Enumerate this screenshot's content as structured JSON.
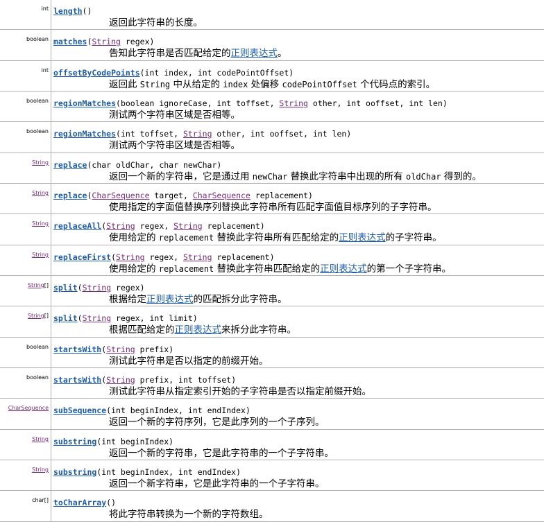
{
  "rows": [
    {
      "type": [
        {
          "text": "int"
        }
      ],
      "name": "length",
      "params": [
        {
          "text": "()"
        }
      ],
      "desc": [
        {
          "text": "返回此字符串的长度。"
        }
      ]
    },
    {
      "type": [
        {
          "text": "boolean"
        }
      ],
      "name": "matches",
      "params": [
        {
          "text": "("
        },
        {
          "text": "String",
          "link": true
        },
        {
          "text": " regex)"
        }
      ],
      "desc": [
        {
          "text": "告知此字符串是否匹配给定的"
        },
        {
          "text": "正则表达式",
          "link": true
        },
        {
          "text": "。"
        }
      ]
    },
    {
      "type": [
        {
          "text": "int"
        }
      ],
      "name": "offsetByCodePoints",
      "params": [
        {
          "text": "(int index, int codePointOffset)"
        }
      ],
      "desc": [
        {
          "text": "返回此 "
        },
        {
          "text": "String",
          "code": true
        },
        {
          "text": " 中从给定的 "
        },
        {
          "text": "index",
          "code": true
        },
        {
          "text": " 处偏移 "
        },
        {
          "text": "codePointOffset",
          "code": true
        },
        {
          "text": " 个代码点的索引。"
        }
      ]
    },
    {
      "type": [
        {
          "text": "boolean"
        }
      ],
      "name": "regionMatches",
      "params": [
        {
          "text": "(boolean ignoreCase, int toffset, "
        },
        {
          "text": "String",
          "link": true
        },
        {
          "text": " other, int ooffset, int len)"
        }
      ],
      "desc": [
        {
          "text": "测试两个字符串区域是否相等。"
        }
      ]
    },
    {
      "type": [
        {
          "text": "boolean"
        }
      ],
      "name": "regionMatches",
      "params": [
        {
          "text": "(int toffset, "
        },
        {
          "text": "String",
          "link": true
        },
        {
          "text": " other, int ooffset, int len)"
        }
      ],
      "desc": [
        {
          "text": "测试两个字符串区域是否相等。"
        }
      ]
    },
    {
      "type": [
        {
          "text": "String",
          "link": true
        }
      ],
      "name": "replace",
      "params": [
        {
          "text": "(char oldChar, char newChar)"
        }
      ],
      "desc": [
        {
          "text": "返回一个新的字符串，它是通过用 "
        },
        {
          "text": "newChar",
          "code": true
        },
        {
          "text": " 替换此字符串中出现的所有 "
        },
        {
          "text": "oldChar",
          "code": true
        },
        {
          "text": " 得到的。"
        }
      ]
    },
    {
      "type": [
        {
          "text": "String",
          "link": true
        }
      ],
      "name": "replace",
      "params": [
        {
          "text": "("
        },
        {
          "text": "CharSequence",
          "link": true
        },
        {
          "text": " target, "
        },
        {
          "text": "CharSequence",
          "link": true
        },
        {
          "text": " replacement)"
        }
      ],
      "desc": [
        {
          "text": "使用指定的字面值替换序列替换此字符串所有匹配字面值目标序列的子字符串。"
        }
      ]
    },
    {
      "type": [
        {
          "text": "String",
          "link": true
        }
      ],
      "name": "replaceAll",
      "params": [
        {
          "text": "("
        },
        {
          "text": "String",
          "link": true
        },
        {
          "text": " regex, "
        },
        {
          "text": "String",
          "link": true
        },
        {
          "text": " replacement)"
        }
      ],
      "desc": [
        {
          "text": "使用给定的 "
        },
        {
          "text": "replacement",
          "code": true
        },
        {
          "text": " 替换此字符串所有匹配给定的"
        },
        {
          "text": "正则表达式",
          "link": true
        },
        {
          "text": "的子字符串。"
        }
      ]
    },
    {
      "type": [
        {
          "text": "String",
          "link": true
        }
      ],
      "name": "replaceFirst",
      "params": [
        {
          "text": "("
        },
        {
          "text": "String",
          "link": true
        },
        {
          "text": " regex, "
        },
        {
          "text": "String",
          "link": true
        },
        {
          "text": " replacement)"
        }
      ],
      "desc": [
        {
          "text": "使用给定的 "
        },
        {
          "text": "replacement",
          "code": true
        },
        {
          "text": " 替换此字符串匹配给定的"
        },
        {
          "text": "正则表达式",
          "link": true
        },
        {
          "text": "的第一个子字符串。"
        }
      ]
    },
    {
      "type": [
        {
          "text": "String",
          "link": true
        },
        {
          "text": "[]"
        }
      ],
      "name": "split",
      "params": [
        {
          "text": "("
        },
        {
          "text": "String",
          "link": true
        },
        {
          "text": " regex)"
        }
      ],
      "desc": [
        {
          "text": "根据给定"
        },
        {
          "text": "正则表达式",
          "link": true
        },
        {
          "text": "的匹配拆分此字符串。"
        }
      ]
    },
    {
      "type": [
        {
          "text": "String",
          "link": true
        },
        {
          "text": "[]"
        }
      ],
      "name": "split",
      "params": [
        {
          "text": "("
        },
        {
          "text": "String",
          "link": true
        },
        {
          "text": " regex, int limit)"
        }
      ],
      "desc": [
        {
          "text": "根据匹配给定的"
        },
        {
          "text": "正则表达式",
          "link": true
        },
        {
          "text": "来拆分此字符串。"
        }
      ]
    },
    {
      "type": [
        {
          "text": "boolean"
        }
      ],
      "name": "startsWith",
      "params": [
        {
          "text": "("
        },
        {
          "text": "String",
          "link": true
        },
        {
          "text": " prefix)"
        }
      ],
      "desc": [
        {
          "text": "测试此字符串是否以指定的前缀开始。"
        }
      ]
    },
    {
      "type": [
        {
          "text": "boolean"
        }
      ],
      "name": "startsWith",
      "params": [
        {
          "text": "("
        },
        {
          "text": "String",
          "link": true
        },
        {
          "text": " prefix, int toffset)"
        }
      ],
      "desc": [
        {
          "text": "测试此字符串从指定索引开始的子字符串是否以指定前缀开始。"
        }
      ]
    },
    {
      "type": [
        {
          "text": "CharSequence",
          "link": true
        }
      ],
      "name": "subSequence",
      "params": [
        {
          "text": "(int beginIndex, int endIndex)"
        }
      ],
      "desc": [
        {
          "text": "返回一个新的字符序列，它是此序列的一个子序列。"
        }
      ]
    },
    {
      "type": [
        {
          "text": "String",
          "link": true
        }
      ],
      "name": "substring",
      "params": [
        {
          "text": "(int beginIndex)"
        }
      ],
      "desc": [
        {
          "text": "返回一个新的字符串，它是此字符串的一个子字符串。"
        }
      ]
    },
    {
      "type": [
        {
          "text": "String",
          "link": true
        }
      ],
      "name": "substring",
      "params": [
        {
          "text": "(int beginIndex, int endIndex)"
        }
      ],
      "desc": [
        {
          "text": "返回一个新字符串，它是此字符串的一个子字符串。"
        }
      ]
    },
    {
      "type": [
        {
          "text": "char"
        },
        {
          "text": "[]"
        }
      ],
      "name": "toCharArray",
      "params": [
        {
          "text": "()"
        }
      ],
      "desc": [
        {
          "text": "将此字符串转换为一个新的字符数组。"
        }
      ]
    }
  ]
}
